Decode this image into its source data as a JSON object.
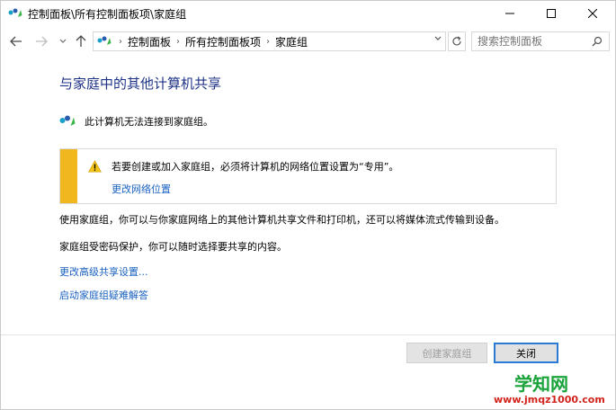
{
  "window": {
    "title": "控制面板\\所有控制面板项\\家庭组",
    "minimize_icon": "minimize-icon",
    "maximize_icon": "maximize-icon",
    "close_icon": "close-icon"
  },
  "nav": {
    "breadcrumbs": [
      "控制面板",
      "所有控制面板项",
      "家庭组"
    ],
    "search_placeholder": "搜索控制面板"
  },
  "main": {
    "heading": "与家庭中的其他计算机共享",
    "status_text": "此计算机无法连接到家庭组。",
    "warning": {
      "text": "若要创建或加入家庭组，必须将计算机的网络位置设置为“专用”。",
      "link": "更改网络位置"
    },
    "paragraph_1": "使用家庭组，你可以与你家庭网络上的其他计算机共享文件和打印机，还可以将媒体流式传输到设备。",
    "paragraph_2": "家庭组受密码保护，你可以随时选择要共享的内容。",
    "link_advanced": "更改高级共享设置...",
    "link_troubleshoot": "启动家庭组疑难解答"
  },
  "footer": {
    "create_label": "创建家庭组",
    "close_label": "关闭"
  },
  "watermark": {
    "title": "学知网",
    "url": "www.jmqz1000.com"
  },
  "colors": {
    "accent": "#1a62c0",
    "heading": "#1e3287",
    "warning_bar": "#f1b71e"
  }
}
